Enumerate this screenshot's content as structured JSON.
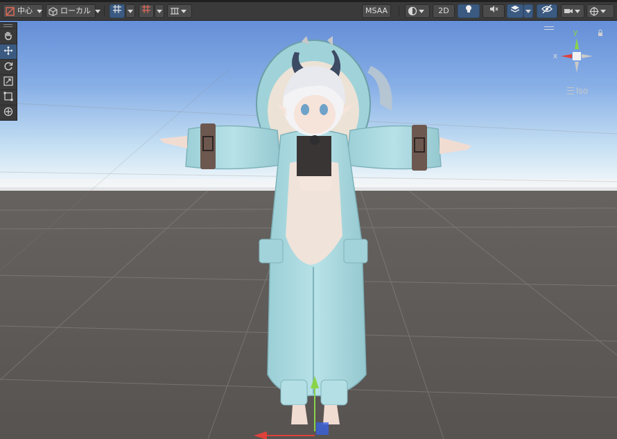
{
  "toolbar": {
    "pivot_label": "中心",
    "space_label": "ローカル",
    "msaa_label": "MSAA",
    "mode_2d_label": "2D"
  },
  "gizmo": {
    "y_label": "y",
    "x_label": "x",
    "projection_label": "Iso"
  },
  "tools": [
    "hand-tool",
    "move-tool",
    "rotate-tool",
    "scale-tool",
    "rect-tool",
    "transform-tool"
  ],
  "colors": {
    "accent": "#3b5a82",
    "sky_top": "#5c86d4",
    "ground": "#5b5755",
    "outfit": "#a9d8df",
    "axis_x": "#e0413a",
    "axis_y": "#8ad44a",
    "axis_z": "#3a62e0"
  }
}
